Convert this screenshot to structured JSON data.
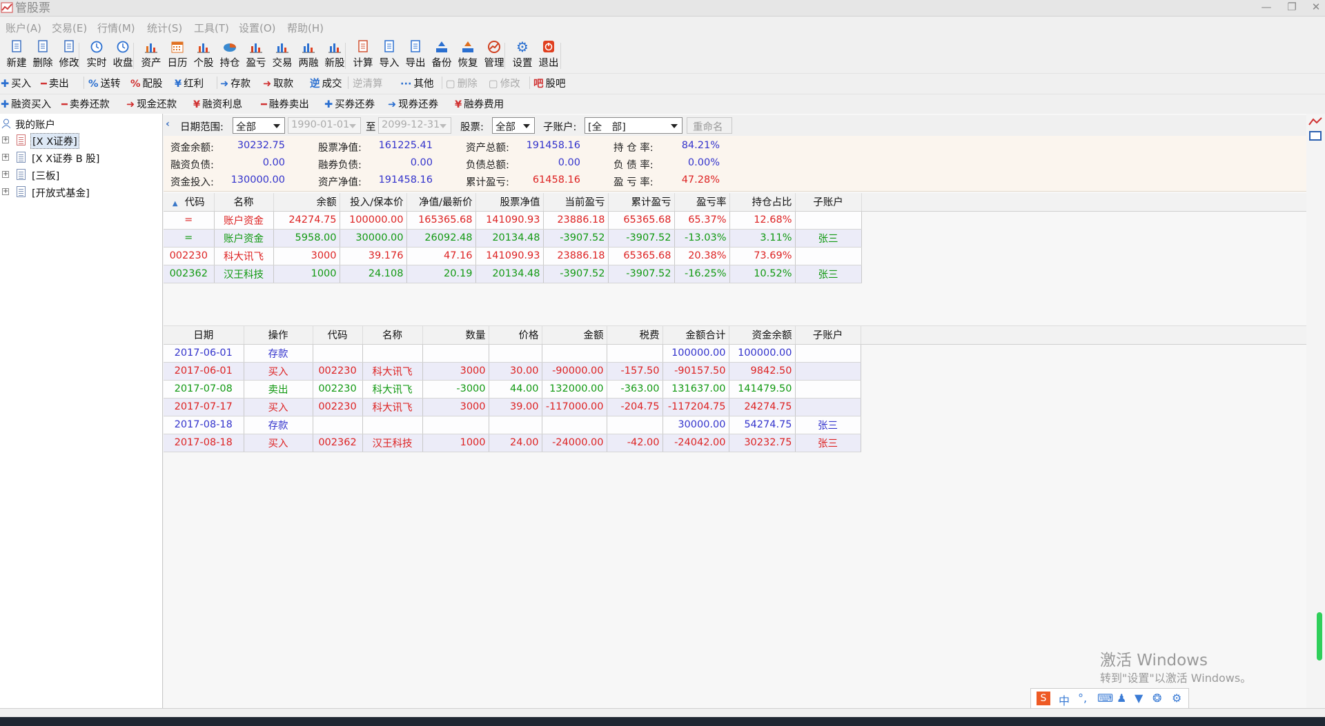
{
  "app": {
    "title": "管股票"
  },
  "menu": [
    "账户(A)",
    "交易(E)",
    "行情(M)",
    "统计(S)",
    "工具(T)",
    "设置(O)",
    "帮助(H)"
  ],
  "toolbar": {
    "buttons": [
      {
        "label": "新建",
        "icon": "new-account-icon"
      },
      {
        "label": "删除",
        "icon": "delete-account-icon"
      },
      {
        "label": "修改",
        "icon": "edit-account-icon"
      },
      {
        "label": "实时",
        "icon": "realtime-clock-icon"
      },
      {
        "label": "收盘",
        "icon": "close-clock-icon"
      },
      {
        "label": "资产",
        "icon": "asset-chart-icon"
      },
      {
        "label": "日历",
        "icon": "calendar-icon"
      },
      {
        "label": "个股",
        "icon": "stock-chart-icon"
      },
      {
        "label": "持仓",
        "icon": "position-pie-icon"
      },
      {
        "label": "盈亏",
        "icon": "profit-chart-icon"
      },
      {
        "label": "交易",
        "icon": "trade-chart-icon"
      },
      {
        "label": "两融",
        "icon": "margin-chart-icon"
      },
      {
        "label": "新股",
        "icon": "ipo-chart-icon"
      },
      {
        "label": "计算",
        "icon": "calculator-icon"
      },
      {
        "label": "导入",
        "icon": "import-icon"
      },
      {
        "label": "导出",
        "icon": "export-icon"
      },
      {
        "label": "备份",
        "icon": "backup-icon"
      },
      {
        "label": "恢复",
        "icon": "restore-icon"
      },
      {
        "label": "管理",
        "icon": "manage-icon"
      },
      {
        "label": "设置",
        "icon": "gear-icon"
      },
      {
        "label": "退出",
        "icon": "exit-icon"
      }
    ]
  },
  "ops1": [
    {
      "sym": "✚",
      "label": "买入",
      "color": "#2a6fd0"
    },
    {
      "sym": "━",
      "label": "卖出",
      "color": "#d03030"
    },
    {
      "sym": "%",
      "label": "送转",
      "color": "#2a6fd0"
    },
    {
      "sym": "%",
      "label": "配股",
      "color": "#d03030"
    },
    {
      "sym": "¥",
      "label": "红利",
      "color": "#2a6fd0"
    },
    {
      "sym": "➜",
      "label": "存款",
      "color": "#2a6fd0"
    },
    {
      "sym": "➜",
      "label": "取款",
      "color": "#d03030"
    },
    {
      "sym": "逆",
      "label": "成交",
      "color": "#2a6fd0"
    },
    {
      "sym": "",
      "label": "逆清算",
      "color": "#aaa"
    },
    {
      "sym": "···",
      "label": "其他",
      "color": "#2a6fd0"
    },
    {
      "sym": "▢",
      "label": "删除",
      "color": "#aaa"
    },
    {
      "sym": "▢",
      "label": "修改",
      "color": "#aaa"
    },
    {
      "sym": "吧",
      "label": "股吧",
      "color": "#d03030"
    }
  ],
  "ops2": [
    {
      "sym": "✚",
      "label": "融资买入",
      "color": "#2a6fd0"
    },
    {
      "sym": "━",
      "label": "卖券还款",
      "color": "#d03030"
    },
    {
      "sym": "➜",
      "label": "现金还款",
      "color": "#d03030"
    },
    {
      "sym": "¥",
      "label": "融资利息",
      "color": "#d03030"
    },
    {
      "sym": "━",
      "label": "融券卖出",
      "color": "#d03030"
    },
    {
      "sym": "✚",
      "label": "买券还券",
      "color": "#2a6fd0"
    },
    {
      "sym": "➜",
      "label": "现券还券",
      "color": "#2a6fd0"
    },
    {
      "sym": "¥",
      "label": "融券费用",
      "color": "#d03030"
    }
  ],
  "sidebar": {
    "root": "我的账户",
    "items": [
      "[X X证券]",
      "[X X证券 B 股]",
      "[三板]",
      "[开放式基金]"
    ]
  },
  "filter": {
    "date_range_label": "日期范围:",
    "date_range_value": "全部",
    "date_from": "1990-01-01",
    "to_label": "至",
    "date_to": "2099-12-31",
    "stock_label": "股票:",
    "stock_value": "全部",
    "subaccount_label": "子账户:",
    "subaccount_value": "[全　部]",
    "rename_label": "重命名"
  },
  "summary": {
    "rows": [
      [
        {
          "label": "资金余额:",
          "value": "30232.75",
          "color": "blue"
        },
        {
          "label": "股票净值:",
          "value": "161225.41",
          "color": "blue"
        },
        {
          "label": "资产总额:",
          "value": "191458.16",
          "color": "blue"
        },
        {
          "label": "持 仓 率:",
          "value": "84.21%",
          "color": "blue"
        }
      ],
      [
        {
          "label": "融资负债:",
          "value": "0.00",
          "color": "blue"
        },
        {
          "label": "融券负债:",
          "value": "0.00",
          "color": "blue"
        },
        {
          "label": "负债总额:",
          "value": "0.00",
          "color": "blue"
        },
        {
          "label": "负 债 率:",
          "value": "0.00%",
          "color": "blue"
        }
      ],
      [
        {
          "label": "资金投入:",
          "value": "130000.00",
          "color": "blue"
        },
        {
          "label": "资产净值:",
          "value": "191458.16",
          "color": "blue"
        },
        {
          "label": "累计盈亏:",
          "value": "61458.16",
          "color": "red"
        },
        {
          "label": "盈 亏 率:",
          "value": "47.28%",
          "color": "red"
        }
      ]
    ]
  },
  "holdings": {
    "headers": [
      "代码",
      "名称",
      "余额",
      "投入/保本价",
      "净值/最新价",
      "股票净值",
      "当前盈亏",
      "累计盈亏",
      "盈亏率",
      "持仓占比",
      "子账户"
    ],
    "rows": [
      {
        "color": "red",
        "cells": [
          "=",
          "账户资金",
          "24274.75",
          "100000.00",
          "165365.68",
          "141090.93",
          "23886.18",
          "65365.68",
          "65.37%",
          "12.68%",
          ""
        ]
      },
      {
        "color": "green",
        "cells": [
          "=",
          "账户资金",
          "5958.00",
          "30000.00",
          "26092.48",
          "20134.48",
          "-3907.52",
          "-3907.52",
          "-13.03%",
          "3.11%",
          "张三"
        ]
      },
      {
        "color": "red",
        "cells": [
          "002230",
          "科大讯飞",
          "3000",
          "39.176",
          "47.16",
          "141090.93",
          "23886.18",
          "65365.68",
          "20.38%",
          "73.69%",
          ""
        ]
      },
      {
        "color": "green",
        "cells": [
          "002362",
          "汉王科技",
          "1000",
          "24.108",
          "20.19",
          "20134.48",
          "-3907.52",
          "-3907.52",
          "-16.25%",
          "10.52%",
          "张三"
        ]
      }
    ]
  },
  "transactions": {
    "headers": [
      "日期",
      "操作",
      "代码",
      "名称",
      "数量",
      "价格",
      "金额",
      "税费",
      "金额合计",
      "资金余额",
      "子账户"
    ],
    "rows": [
      {
        "color": "blue",
        "cells": [
          "2017-06-01",
          "存款",
          "",
          "",
          "",
          "",
          "",
          "",
          "100000.00",
          "100000.00",
          ""
        ]
      },
      {
        "color": "red",
        "cells": [
          "2017-06-01",
          "买入",
          "002230",
          "科大讯飞",
          "3000",
          "30.00",
          "-90000.00",
          "-157.50",
          "-90157.50",
          "9842.50",
          ""
        ]
      },
      {
        "color": "green",
        "cells": [
          "2017-07-08",
          "卖出",
          "002230",
          "科大讯飞",
          "-3000",
          "44.00",
          "132000.00",
          "-363.00",
          "131637.00",
          "141479.50",
          ""
        ]
      },
      {
        "color": "red",
        "cells": [
          "2017-07-17",
          "买入",
          "002230",
          "科大讯飞",
          "3000",
          "39.00",
          "-117000.00",
          "-204.75",
          "-117204.75",
          "24274.75",
          ""
        ]
      },
      {
        "color": "blue",
        "cells": [
          "2017-08-18",
          "存款",
          "",
          "",
          "",
          "",
          "",
          "",
          "30000.00",
          "54274.75",
          "张三"
        ]
      },
      {
        "color": "red",
        "cells": [
          "2017-08-18",
          "买入",
          "002362",
          "汉王科技",
          "1000",
          "24.00",
          "-24000.00",
          "-42.00",
          "-24042.00",
          "30232.75",
          "张三"
        ]
      }
    ]
  },
  "os": {
    "watermark_title": "激活 Windows",
    "watermark_sub": "转到\"设置\"以激活 Windows。",
    "ime_mode": "中"
  }
}
